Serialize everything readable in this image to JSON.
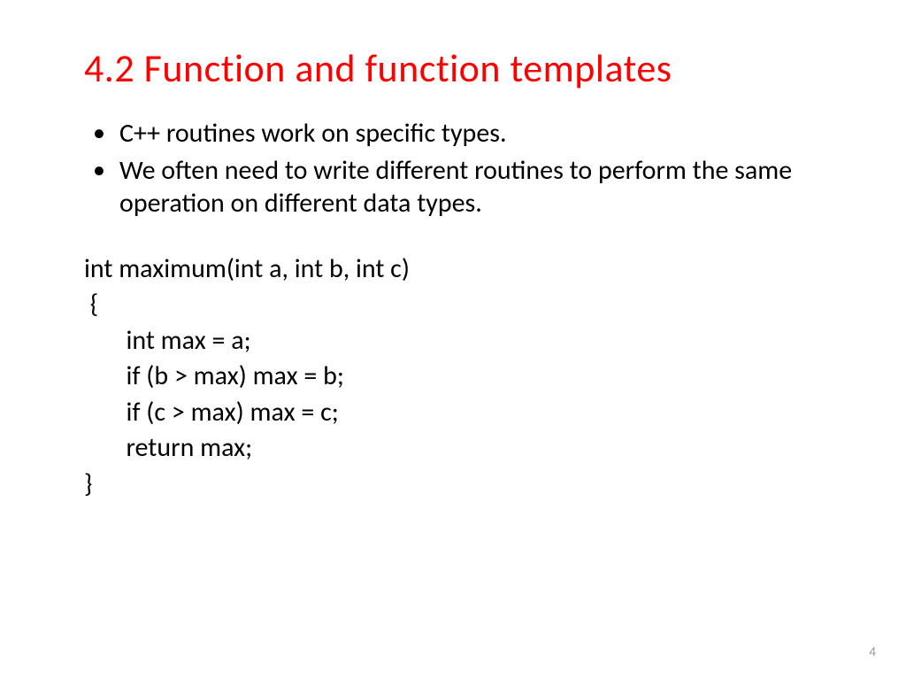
{
  "title": "4.2 Function and function templates",
  "bullets": [
    "C++ routines work on specific types.",
    "We often need to write different routines to perform the same operation on different data types."
  ],
  "code": "int maximum(int a, int b, int c)\n {\n       int max = a;\n       if (b > max) max = b;\n       if (c > max) max = c;\n       return max;\n}",
  "pageNumber": "4"
}
